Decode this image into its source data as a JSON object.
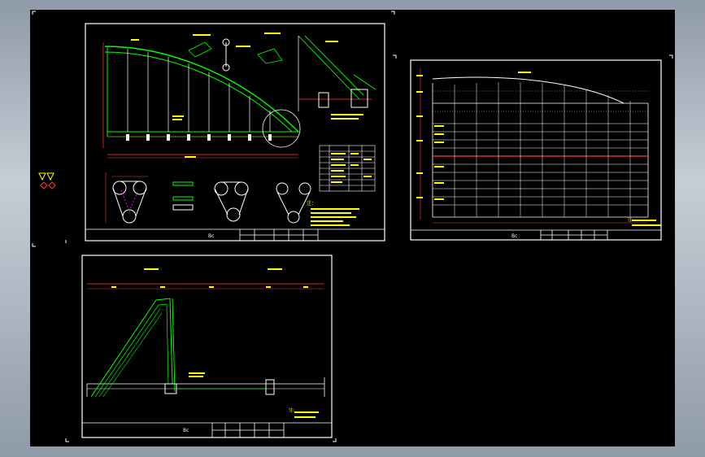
{
  "colors": {
    "background": "#000000",
    "outline": "#ffffff",
    "structure": "#00ff00",
    "dimension": "#ff3b3b",
    "annotation": "#ffff00",
    "centerline": "#00ffff"
  },
  "sheet1": {
    "title_block_label": "Bc",
    "note_header": "注："
  },
  "sheet2": {
    "title_block_label": "Bc",
    "note_header": "注："
  },
  "sheet3": {
    "title_block_label": "Bc",
    "note_header": "注："
  },
  "icons": [
    "triangle-marker-icon",
    "hexagon-marker-icon"
  ]
}
